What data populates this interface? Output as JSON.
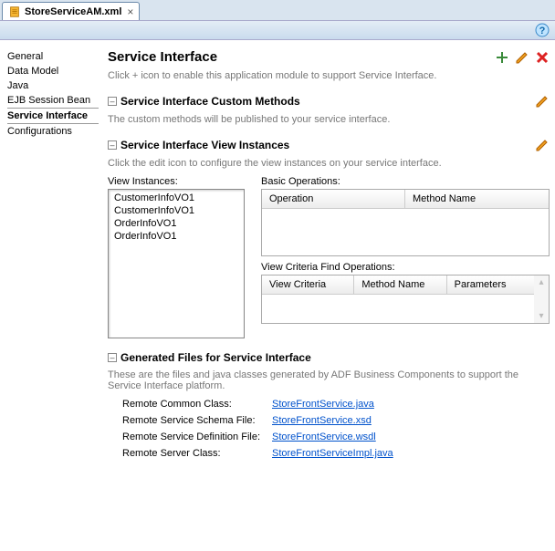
{
  "tab": {
    "title": "StoreServiceAM.xml"
  },
  "sidebar": {
    "items": [
      {
        "label": "General"
      },
      {
        "label": "Data Model"
      },
      {
        "label": "Java"
      },
      {
        "label": "EJB Session Bean"
      },
      {
        "label": "Service Interface"
      },
      {
        "label": "Configurations"
      }
    ],
    "active_index": 4
  },
  "main": {
    "title": "Service Interface",
    "intro": "Click + icon to enable this application module to support Service Interface."
  },
  "custom_methods": {
    "title": "Service Interface Custom Methods",
    "desc": "The custom methods will be published to your service interface."
  },
  "view_instances": {
    "title": "Service Interface View Instances",
    "desc": "Click the edit icon to configure the view instances on your service interface.",
    "list_label": "View Instances:",
    "items": [
      "CustomerInfoVO1",
      "CustomerInfoVO1",
      "OrderInfoVO1",
      "OrderInfoVO1"
    ],
    "basic_ops_label": "Basic Operations:",
    "basic_ops_cols": {
      "c0": "Operation",
      "c1": "Method Name"
    },
    "criteria_label": "View Criteria Find Operations:",
    "criteria_cols": {
      "c0": "View Criteria",
      "c1": "Method Name",
      "c2": "Parameters"
    }
  },
  "generated": {
    "title": "Generated Files for Service Interface",
    "desc": "These are the files and java classes generated by ADF Business Components to support the Service Interface platform.",
    "rows": [
      {
        "label": "Remote Common Class:",
        "link": "StoreFrontService.java"
      },
      {
        "label": "Remote Service Schema File:",
        "link": "StoreFrontService.xsd"
      },
      {
        "label": "Remote Service Definition File:",
        "link": "StoreFrontService.wsdl"
      },
      {
        "label": "Remote Server Class:",
        "link": "StoreFrontServiceImpl.java"
      }
    ]
  }
}
